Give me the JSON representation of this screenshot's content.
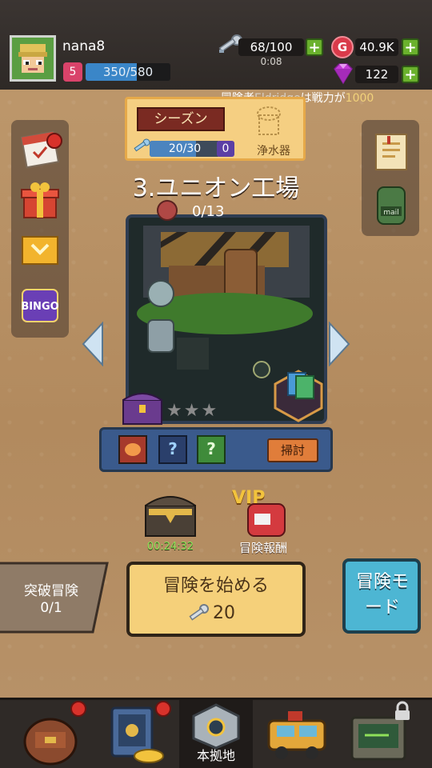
{
  "player": {
    "name": "nana8",
    "level": "5",
    "exp": "350/580",
    "exp_ratio": 0.6
  },
  "resources": {
    "energy": "68/100",
    "energy_timer": "0:08",
    "gold": "40.9K",
    "gems": "122"
  },
  "notice": {
    "prefix": "冒険者",
    "name": "Eldridge",
    "middle": "は戦力が",
    "value": "1000"
  },
  "season": {
    "label": "シーズン",
    "progress": "20/30",
    "count": "0",
    "reward": "浄水器"
  },
  "stage": {
    "title": "3.ユニオン工場",
    "progress": "0/13",
    "stars": "★★★"
  },
  "actions": {
    "sweep": "掃討"
  },
  "chest": {
    "timer": "00:24:32"
  },
  "vip": {
    "badge": "VIP",
    "label": "冒険報酬"
  },
  "breakthrough": {
    "title": "突破冒険",
    "count": "0/1"
  },
  "start": {
    "label": "冒険を始める",
    "cost": "20"
  },
  "mode": {
    "label": "冒険モード"
  },
  "nav": {
    "home": "本拠地"
  },
  "colors": {
    "accent_gold": "#f2d27a",
    "exp_bar": "#3a86c8",
    "gold_icon": "#d93a4a",
    "gem": "#c43ad8",
    "plus": "#6ab12d",
    "mode_button": "#4db6d3"
  }
}
